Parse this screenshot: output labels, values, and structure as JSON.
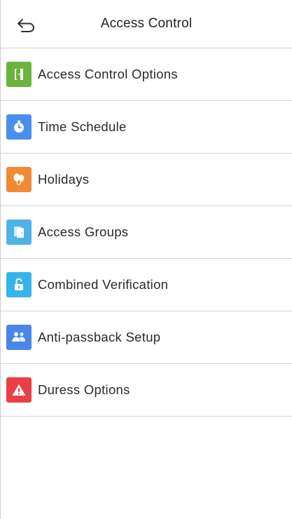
{
  "header": {
    "title": "Access Control",
    "back_icon": "back-arrow-icon"
  },
  "menu": {
    "items": [
      {
        "label": "Access Control Options",
        "icon": "door-icon",
        "color": "#6ab43e"
      },
      {
        "label": "Time Schedule",
        "icon": "clock-icon",
        "color": "#4a8ff0"
      },
      {
        "label": "Holidays",
        "icon": "balloons-icon",
        "color": "#f08a35"
      },
      {
        "label": "Access Groups",
        "icon": "group-door-icon",
        "color": "#4fb3e8"
      },
      {
        "label": "Combined Verification",
        "icon": "unlock-icon",
        "color": "#35b4ec"
      },
      {
        "label": "Anti-passback Setup",
        "icon": "users-icon",
        "color": "#4a85ea"
      },
      {
        "label": "Duress Options",
        "icon": "warning-icon",
        "color": "#ec3e47"
      }
    ]
  }
}
